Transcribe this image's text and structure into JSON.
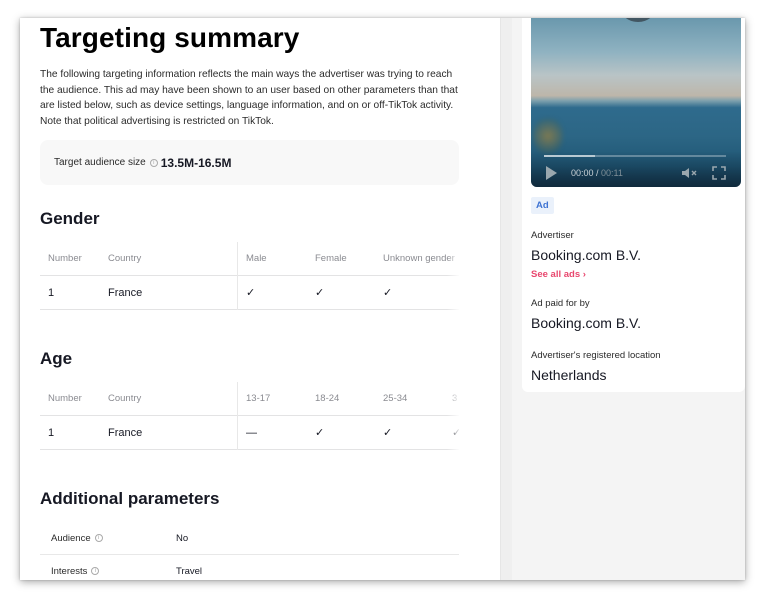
{
  "page": {
    "title": "Targeting summary",
    "intro": "The following targeting information reflects the main ways the advertiser was trying to reach the audience. This ad may have been shown to an user based on other parameters than that are listed below, such as device settings, language information, and on or off-TikTok activity. Note that political advertising is restricted on TikTok."
  },
  "audience": {
    "label": "Target audience size",
    "info_icon": "info-icon",
    "value": "13.5M-16.5M"
  },
  "gender": {
    "title": "Gender",
    "columns": [
      "Number",
      "Country",
      "Male",
      "Female",
      "Unknown gender"
    ],
    "rows": [
      {
        "number": "1",
        "country": "France",
        "values": [
          "check",
          "check",
          "check"
        ]
      }
    ]
  },
  "age": {
    "title": "Age",
    "columns": [
      "Number",
      "Country",
      "13-17",
      "18-24",
      "25-34",
      "3"
    ],
    "rows": [
      {
        "number": "1",
        "country": "France",
        "values": [
          "dash",
          "check",
          "check",
          "check"
        ]
      }
    ]
  },
  "additional": {
    "title": "Additional parameters",
    "rows": [
      {
        "label": "Audience",
        "value": "No"
      },
      {
        "label": "Interests",
        "value": "Travel"
      }
    ]
  },
  "symbols": {
    "check": "✓",
    "dash": "—",
    "info": "i",
    "chevron": "›"
  },
  "video": {
    "current_time": "00:00",
    "separator": " / ",
    "duration": "00:11",
    "progress_fraction": 0.28,
    "muted": true
  },
  "ad_info": {
    "badge": "Ad",
    "advertiser_label": "Advertiser",
    "advertiser": "Booking.com B.V.",
    "see_all_label": "See all ads",
    "paid_by_label": "Ad paid for by",
    "paid_by": "Booking.com B.V.",
    "location_label": "Advertiser's registered location",
    "location": "Netherlands"
  },
  "colors": {
    "accent_pink": "#e8476e",
    "check": "#d4456b",
    "badge_blue": "#3f74d3",
    "badge_bg": "#eaf1fb"
  }
}
